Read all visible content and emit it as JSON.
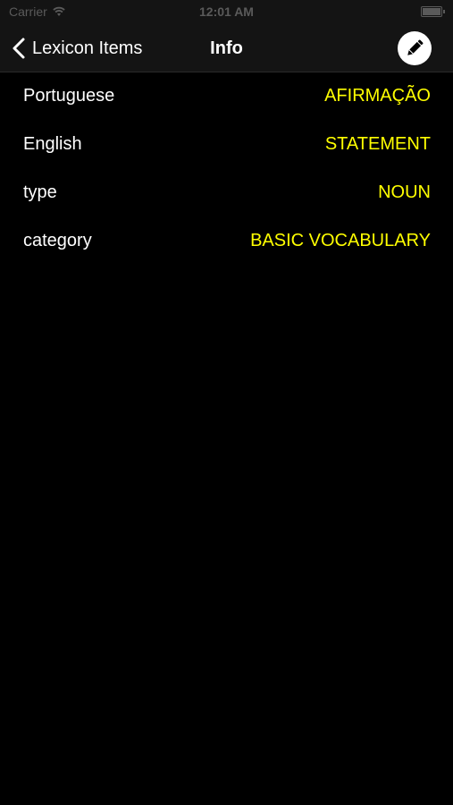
{
  "status_bar": {
    "carrier": "Carrier",
    "time": "12:01 AM"
  },
  "nav": {
    "back_label": "Lexicon Items",
    "title": "Info",
    "edit_icon": "pencil-icon"
  },
  "rows": [
    {
      "label": "Portuguese",
      "value": "AFIRMAÇÃO"
    },
    {
      "label": "English",
      "value": "STATEMENT"
    },
    {
      "label": "type",
      "value": "NOUN"
    },
    {
      "label": "category",
      "value": "BASIC VOCABULARY"
    }
  ],
  "colors": {
    "background": "#000000",
    "label": "#ffffff",
    "value": "#ffff00"
  }
}
